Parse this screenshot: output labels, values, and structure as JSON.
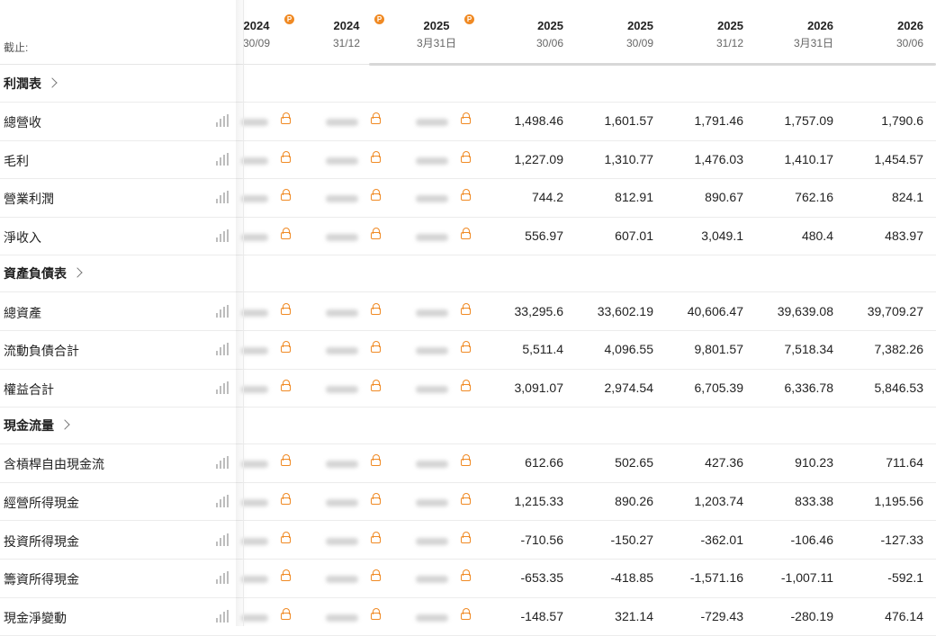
{
  "header": {
    "as_of_label": "截止:",
    "premium_badge": "P",
    "columns": [
      {
        "year": "2024",
        "date": "30/09",
        "premium": true
      },
      {
        "year": "2024",
        "date": "31/12",
        "premium": true
      },
      {
        "year": "2025",
        "date": "3月31日",
        "premium": true
      },
      {
        "year": "2025",
        "date": "30/06",
        "premium": false
      },
      {
        "year": "2025",
        "date": "30/09",
        "premium": false
      },
      {
        "year": "2025",
        "date": "31/12",
        "premium": false
      },
      {
        "year": "2026",
        "date": "3月31日",
        "premium": false
      },
      {
        "year": "2026",
        "date": "30/06",
        "premium": false
      }
    ]
  },
  "sections": [
    {
      "title": "利潤表",
      "rows": [
        {
          "label": "總營收",
          "values": [
            "1,498.46",
            "1,601.57",
            "1,791.46",
            "1,757.09",
            "1,790.6"
          ]
        },
        {
          "label": "毛利",
          "values": [
            "1,227.09",
            "1,310.77",
            "1,476.03",
            "1,410.17",
            "1,454.57"
          ]
        },
        {
          "label": "營業利潤",
          "values": [
            "744.2",
            "812.91",
            "890.67",
            "762.16",
            "824.1"
          ]
        },
        {
          "label": "淨收入",
          "values": [
            "556.97",
            "607.01",
            "3,049.1",
            "480.4",
            "483.97"
          ]
        }
      ]
    },
    {
      "title": "資產負債表",
      "rows": [
        {
          "label": "總資產",
          "values": [
            "33,295.6",
            "33,602.19",
            "40,606.47",
            "39,639.08",
            "39,709.27"
          ]
        },
        {
          "label": "流動負債合計",
          "values": [
            "5,511.4",
            "4,096.55",
            "9,801.57",
            "7,518.34",
            "7,382.26"
          ]
        },
        {
          "label": "權益合計",
          "values": [
            "3,091.07",
            "2,974.54",
            "6,705.39",
            "6,336.78",
            "5,846.53"
          ]
        }
      ]
    },
    {
      "title": "現金流量",
      "rows": [
        {
          "label": "含槓桿自由現金流",
          "values": [
            "612.66",
            "502.65",
            "427.36",
            "910.23",
            "711.64"
          ]
        },
        {
          "label": "經營所得現金",
          "values": [
            "1,215.33",
            "890.26",
            "1,203.74",
            "833.38",
            "1,195.56"
          ]
        },
        {
          "label": "投資所得現金",
          "values": [
            "-710.56",
            "-150.27",
            "-362.01",
            "-106.46",
            "-127.33"
          ]
        },
        {
          "label": "籌資所得現金",
          "values": [
            "-653.35",
            "-418.85",
            "-1,571.16",
            "-1,007.11",
            "-592.1"
          ]
        },
        {
          "label": "現金淨變動",
          "values": [
            "-148.57",
            "321.14",
            "-729.43",
            "-280.19",
            "476.14"
          ]
        }
      ]
    }
  ],
  "icons": {
    "row_chart": "bar-chart-icon",
    "locked": "lock-icon",
    "section_link": "chevron-right-icon"
  },
  "colors": {
    "accent": "#f08a24",
    "text": "#222222",
    "muted": "#666666"
  }
}
